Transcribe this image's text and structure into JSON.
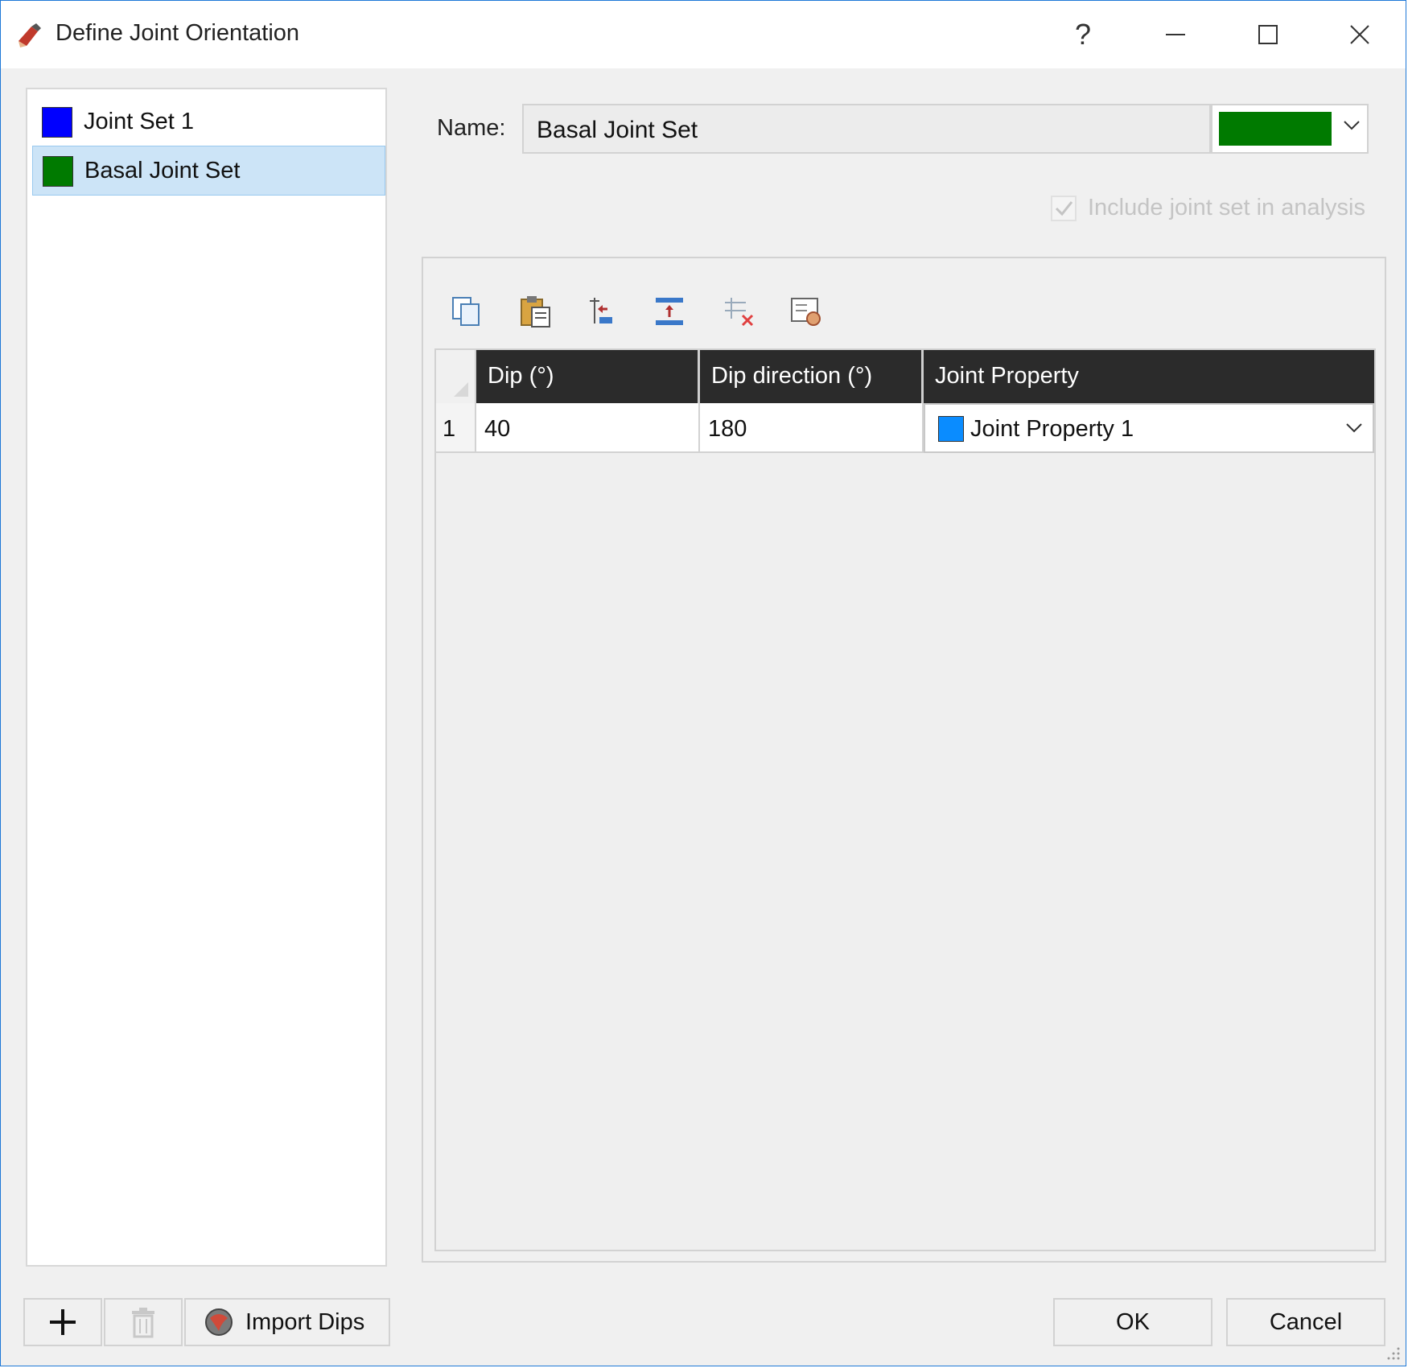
{
  "window": {
    "title": "Define Joint Orientation",
    "help_label": "?"
  },
  "joint_sets": [
    {
      "label": "Joint Set 1",
      "color": "#0000ff",
      "selected": false
    },
    {
      "label": "Basal Joint Set",
      "color": "#007a00",
      "selected": true
    }
  ],
  "form": {
    "name_label": "Name:",
    "name_value": "Basal Joint Set",
    "color_value": "#007a00",
    "include_label": "Include joint set in analysis",
    "include_checked": true,
    "include_enabled": false
  },
  "toolbar": {
    "icons": [
      "copy-icon",
      "paste-icon",
      "import-rows-icon",
      "insert-row-icon",
      "delete-rows-icon",
      "properties-icon"
    ]
  },
  "table": {
    "headers": [
      "Dip (°)",
      "Dip direction (°)",
      "Joint Property"
    ],
    "rows": [
      {
        "row_number": "1",
        "dip": "40",
        "dip_direction": "180",
        "joint_property": "Joint Property 1",
        "joint_property_color": "#0a8cff"
      }
    ]
  },
  "buttons": {
    "add_icon": "plus-icon",
    "delete_icon": "trash-icon",
    "import_label": "Import Dips",
    "ok_label": "OK",
    "cancel_label": "Cancel"
  }
}
